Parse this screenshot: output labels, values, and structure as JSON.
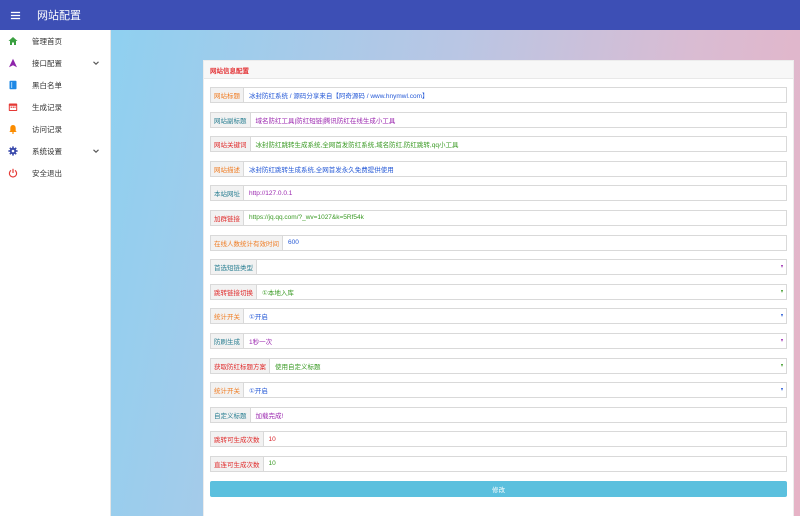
{
  "app": {
    "title": "网站配置"
  },
  "sidebar": {
    "items": [
      {
        "label": "管理首页",
        "icon": "home-icon",
        "color": "#3aa040",
        "caret": false
      },
      {
        "label": "接口配置",
        "icon": "send-icon",
        "color": "#8e24aa",
        "caret": true
      },
      {
        "label": "黑白名单",
        "icon": "book-icon",
        "color": "#1e88e5",
        "caret": false
      },
      {
        "label": "生成记录",
        "icon": "calendar-icon",
        "color": "#e53935",
        "caret": false
      },
      {
        "label": "访问记录",
        "icon": "bell-icon",
        "color": "#fb8c00",
        "caret": false
      },
      {
        "label": "系统设置",
        "icon": "gear-icon",
        "color": "#3949ab",
        "caret": true
      },
      {
        "label": "安全退出",
        "icon": "power-icon",
        "color": "#e53935",
        "caret": false
      }
    ]
  },
  "card": {
    "title": "网站信息配置"
  },
  "form": {
    "fields": [
      {
        "label": "网站标题",
        "label_color": "orange",
        "value": "冰封防红系统 / 源码分享来自【阿奇源码 / www.hnymwl.com】",
        "value_color": "blue",
        "type": "text"
      },
      {
        "label": "网站副标题",
        "label_color": "teal",
        "value": "域名防红工具|防红短链|腾讯防红在线生成小工具",
        "value_color": "purple",
        "type": "text"
      },
      {
        "label": "网站关键词",
        "label_color": "red",
        "value": "冰封防红跳转生成系统,全网首发防红系统,域名防红,防红跳转,qq小工具",
        "value_color": "green",
        "type": "text"
      },
      {
        "label": "网站描述",
        "label_color": "orange",
        "value": "冰封防红跳转生成系统,全网首发永久免费提供使用",
        "value_color": "blue",
        "type": "text"
      },
      {
        "label": "本站网址",
        "label_color": "teal",
        "value": "http://127.0.0.1",
        "value_color": "purple",
        "type": "text"
      },
      {
        "label": "加群链接",
        "label_color": "red",
        "value": "https://jq.qq.com/?_wv=1027&k=5Rf54k",
        "value_color": "green",
        "type": "text"
      },
      {
        "label": "在线人数统计有效时间",
        "label_color": "orange",
        "value": "600",
        "value_color": "blue",
        "type": "text"
      },
      {
        "label": "首选短链类型",
        "label_color": "teal",
        "value": "",
        "value_color": "purple",
        "type": "select"
      },
      {
        "label": "跳转链接切换",
        "label_color": "red",
        "value": "①本地入库",
        "value_color": "green",
        "type": "select"
      },
      {
        "label": "统计开关",
        "label_color": "orange",
        "value": "①开启",
        "value_color": "blue",
        "type": "select"
      },
      {
        "label": "防刷生成",
        "label_color": "teal",
        "value": "1秒一次",
        "value_color": "purple",
        "type": "select"
      },
      {
        "label": "获取防红标题方案",
        "label_color": "red",
        "value": "使用自定义标题",
        "value_color": "green",
        "type": "select"
      },
      {
        "label": "统计开关",
        "label_color": "orange",
        "value": "①开启",
        "value_color": "blue",
        "type": "select"
      },
      {
        "label": "自定义标题",
        "label_color": "teal",
        "value": "加载完成!",
        "value_color": "purple",
        "type": "text"
      },
      {
        "label": "跳转可生成次数",
        "label_color": "red",
        "value": "10",
        "value_color": "red",
        "type": "text"
      },
      {
        "label": "直连可生成次数",
        "label_color": "red",
        "value": "10",
        "value_color": "green",
        "type": "text"
      }
    ],
    "submit_label": "修改"
  }
}
